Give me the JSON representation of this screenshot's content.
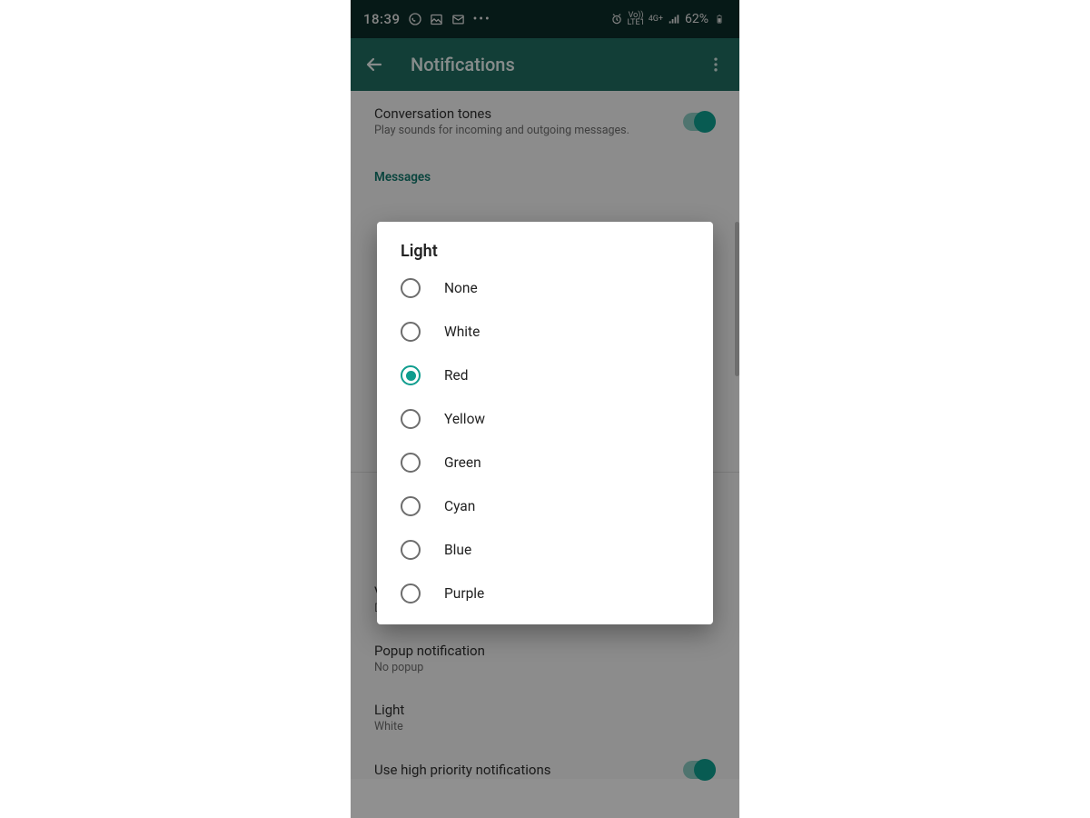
{
  "status": {
    "time": "18:39",
    "battery": "62%",
    "net1": "Vo))",
    "net1b": "LTE1",
    "net2": "4G+"
  },
  "appbar": {
    "title": "Notifications"
  },
  "settings": {
    "conversation_tones_title": "Conversation tones",
    "conversation_tones_sub": "Play sounds for incoming and outgoing messages.",
    "section_messages": "Messages",
    "vibrate_title": "Vibrate",
    "vibrate_sub": "Default",
    "popup_title": "Popup notification",
    "popup_sub": "No popup",
    "light_title": "Light",
    "light_sub": "White",
    "high_priority_title": "Use high priority notifications"
  },
  "dialog": {
    "title": "Light",
    "selected_index": 2,
    "options": [
      "None",
      "White",
      "Red",
      "Yellow",
      "Green",
      "Cyan",
      "Blue",
      "Purple"
    ]
  }
}
